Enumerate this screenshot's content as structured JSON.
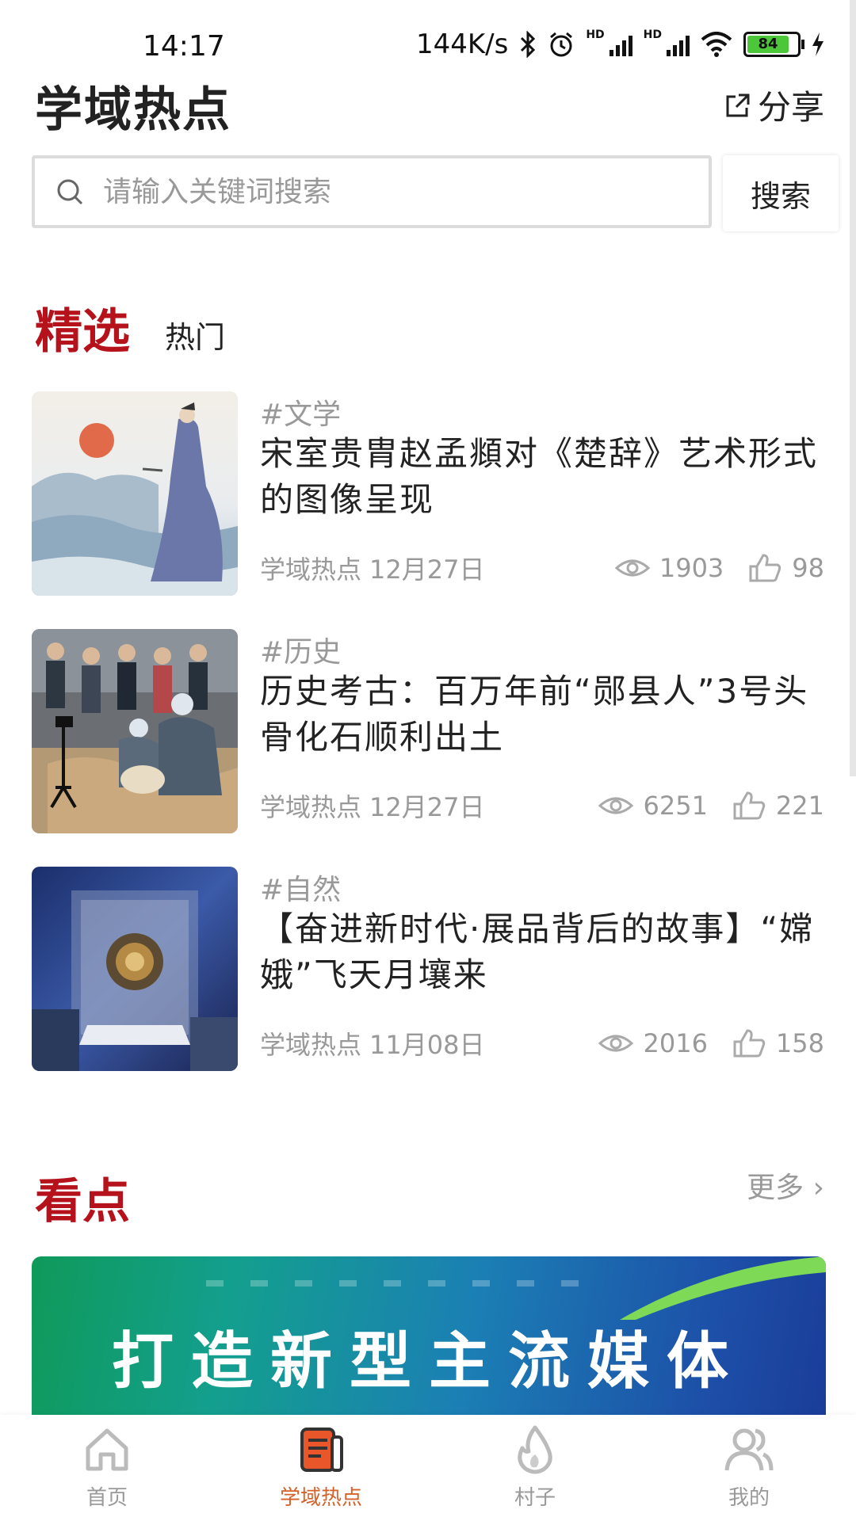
{
  "status_bar": {
    "time": "14:17",
    "net_speed": "144K/s",
    "battery": "84",
    "signal_hd1": "HD",
    "signal_hd2": "HD"
  },
  "header": {
    "title": "学域热点",
    "share_label": "分享"
  },
  "search": {
    "placeholder": "请输入关键词搜索",
    "button_label": "搜索"
  },
  "tabs": [
    {
      "label": "精选",
      "active": true
    },
    {
      "label": "热门",
      "active": false
    }
  ],
  "articles": [
    {
      "tag": "#文学",
      "title": "宋室贵胄赵孟頫对《楚辞》艺术形式的图像呈现",
      "source": "学域热点",
      "date": "12月27日",
      "views": "1903",
      "likes": "98"
    },
    {
      "tag": "#历史",
      "title": "历史考古：百万年前“郧县人”3号头骨化石顺利出土",
      "source": "学域热点",
      "date": "12月27日",
      "views": "6251",
      "likes": "221"
    },
    {
      "tag": "#自然",
      "title": "【奋进新时代·展品背后的故事】“嫦娥”飞天月壤来",
      "source": "学域热点",
      "date": "11月08日",
      "views": "2016",
      "likes": "158"
    }
  ],
  "section_kandian": {
    "title": "看点",
    "more_label": "更多 ›",
    "banner_text": "打造新型主流媒体"
  },
  "bottom_nav": [
    {
      "label": "首页",
      "icon": "home-icon",
      "active": false
    },
    {
      "label": "学域热点",
      "icon": "news-icon",
      "active": true
    },
    {
      "label": "村子",
      "icon": "flame-icon",
      "active": false
    },
    {
      "label": "我的",
      "icon": "user-icon",
      "active": false
    }
  ],
  "colors": {
    "accent_red": "#b5121b",
    "nav_active": "#d4622a",
    "muted": "#999999"
  }
}
